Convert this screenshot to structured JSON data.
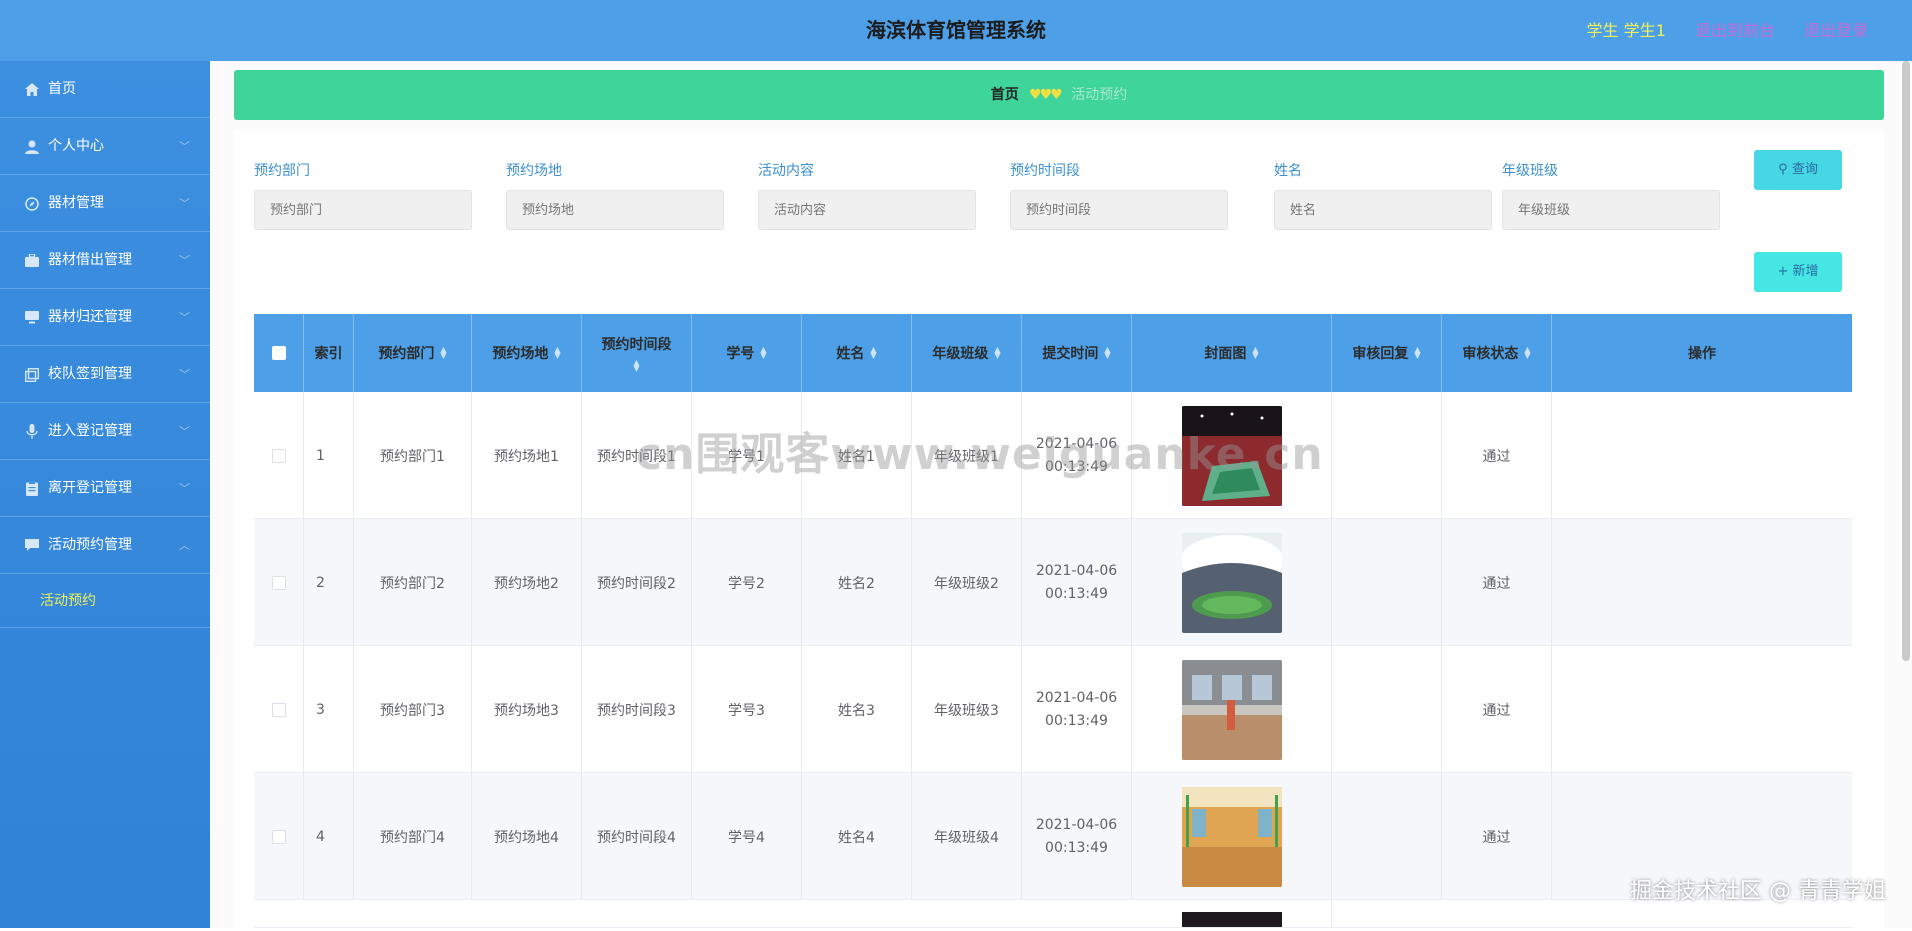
{
  "header": {
    "title": "海滨体育馆管理系统",
    "user": "学生 学生1",
    "links": [
      "退出到前台",
      "退出登录"
    ]
  },
  "sidebar": {
    "items": [
      {
        "label": "首页",
        "icon": "home-icon"
      },
      {
        "label": "个人中心",
        "icon": "user-icon"
      },
      {
        "label": "器材管理",
        "icon": "compass-icon"
      },
      {
        "label": "器材借出管理",
        "icon": "briefcase-icon"
      },
      {
        "label": "器材归还管理",
        "icon": "monitor-icon"
      },
      {
        "label": "校队签到管理",
        "icon": "copy-icon"
      },
      {
        "label": "进入登记管理",
        "icon": "mic-icon"
      },
      {
        "label": "离开登记管理",
        "icon": "clipboard-icon"
      },
      {
        "label": "活动预约管理",
        "icon": "chat-icon"
      }
    ],
    "submenu": "活动预约"
  },
  "breadcrumb": {
    "home": "首页",
    "sep": "♥♥♥",
    "current": "活动预约"
  },
  "search": {
    "fields": [
      {
        "label": "预约部门",
        "placeholder": "预约部门"
      },
      {
        "label": "预约场地",
        "placeholder": "预约场地"
      },
      {
        "label": "活动内容",
        "placeholder": "活动内容"
      },
      {
        "label": "预约时间段",
        "placeholder": "预约时间段"
      },
      {
        "label": "姓名",
        "placeholder": "姓名"
      },
      {
        "label": "年级班级",
        "placeholder": "年级班级"
      }
    ],
    "search_button": "查询",
    "add_button": "新增"
  },
  "table": {
    "columns": [
      "索引",
      "预约部门",
      "预约场地",
      "预约时间段",
      "学号",
      "姓名",
      "年级班级",
      "提交时间",
      "封面图",
      "审核回复",
      "审核状态",
      "操作"
    ],
    "rows": [
      {
        "index": "1",
        "dept": "预约部门1",
        "venue": "预约场地1",
        "period": "预约时间段1",
        "sid": "学号1",
        "name": "姓名1",
        "cls": "年级班级1",
        "date": "2021-04-06",
        "time": "00:13:49",
        "reply": "",
        "status": "通过"
      },
      {
        "index": "2",
        "dept": "预约部门2",
        "venue": "预约场地2",
        "period": "预约时间段2",
        "sid": "学号2",
        "name": "姓名2",
        "cls": "年级班级2",
        "date": "2021-04-06",
        "time": "00:13:49",
        "reply": "",
        "status": "通过"
      },
      {
        "index": "3",
        "dept": "预约部门3",
        "venue": "预约场地3",
        "period": "预约时间段3",
        "sid": "学号3",
        "name": "姓名3",
        "cls": "年级班级3",
        "date": "2021-04-06",
        "time": "00:13:49",
        "reply": "",
        "status": "通过"
      },
      {
        "index": "4",
        "dept": "预约部门4",
        "venue": "预约场地4",
        "period": "预约时间段4",
        "sid": "学号4",
        "name": "姓名4",
        "cls": "年级班级4",
        "date": "2021-04-06",
        "time": "00:13:49",
        "reply": "",
        "status": "通过"
      }
    ]
  },
  "watermarks": {
    "center": "cn围观客www.weiguanke.cn",
    "footer": "掘金技术社区 @ 青青学姐"
  },
  "colors": {
    "header": "#4da0e8",
    "sidebar": "#3d8fe0",
    "breadcrumb": "#3fd49a",
    "accent_user": "#f0f05a",
    "accent_link": "#c76bd6"
  }
}
